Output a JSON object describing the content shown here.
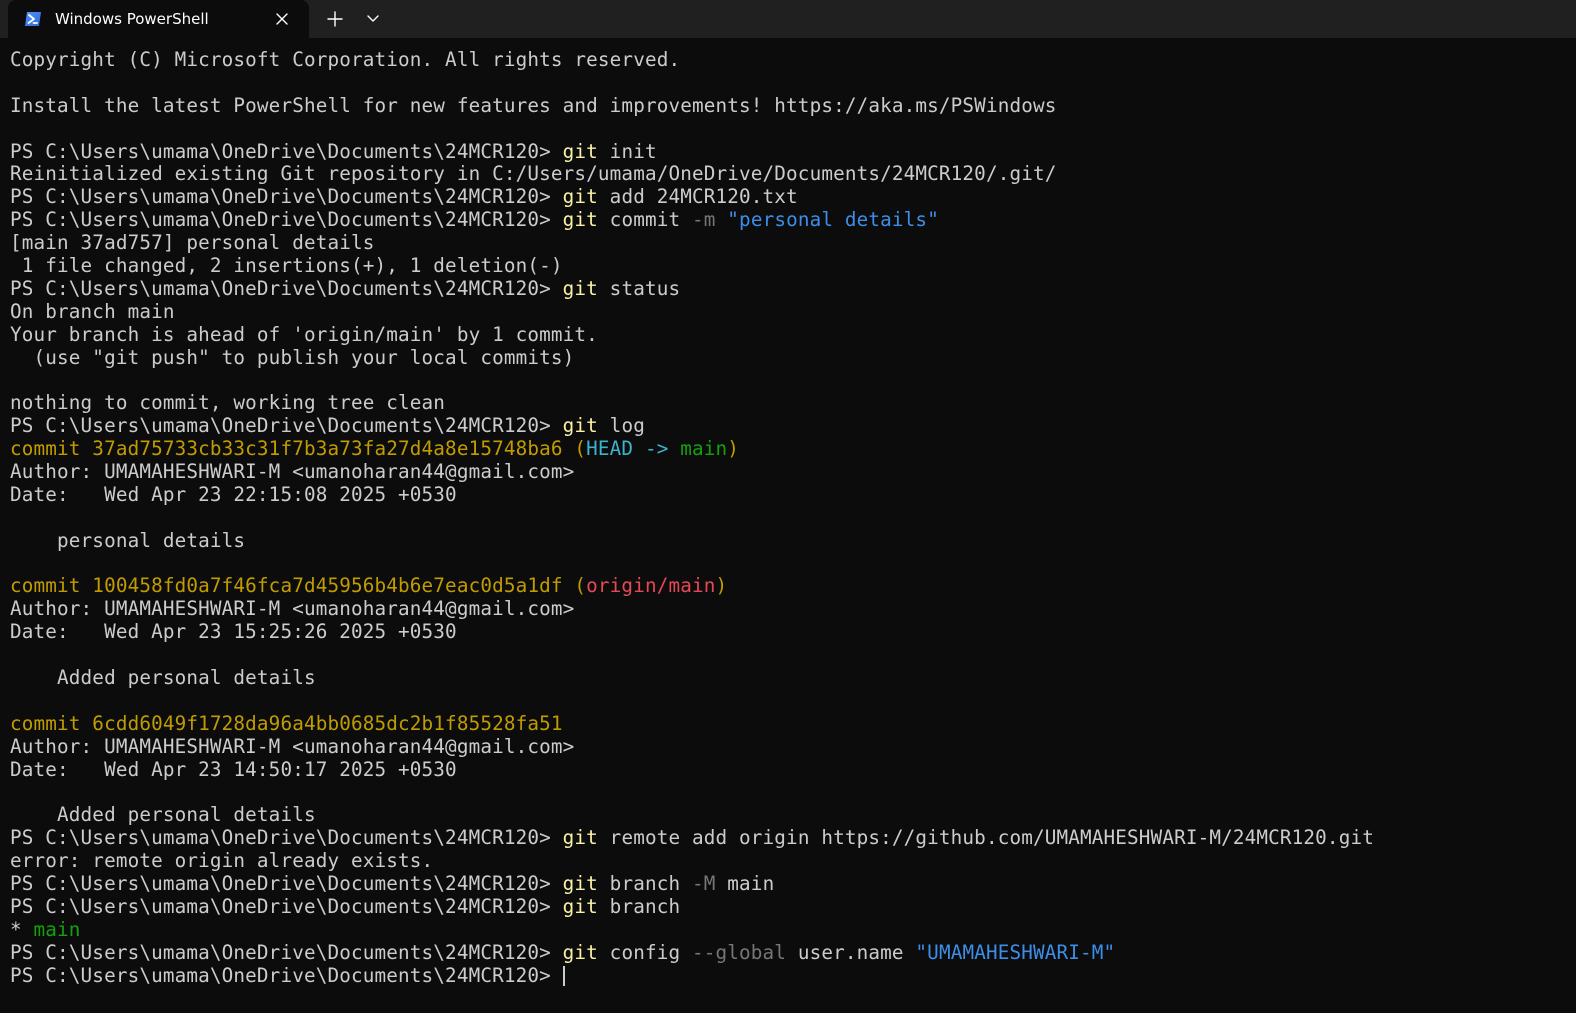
{
  "window": {
    "tab_title": "Windows PowerShell",
    "new_tab_label": "+",
    "icons": {
      "tab_icon": "powershell-icon",
      "close": "close-icon",
      "new_tab": "plus-icon",
      "dropdown": "chevron-down-icon"
    }
  },
  "colors": {
    "background": "#0c0c0c",
    "titlebar": "#202020",
    "text": "#cccccc",
    "command": "#f9f1a5",
    "flag": "#767676",
    "string": "#3b8eea",
    "commit_hash": "#c19c00",
    "head": "#3bb4cf",
    "branch": "#13a10e",
    "remote_branch": "#e74856"
  },
  "terminal": {
    "prompt": "PS C:\\Users\\umama\\OneDrive\\Documents\\24MCR120> ",
    "lines": [
      {
        "segments": [
          {
            "t": "Copyright (C) Microsoft Corporation. All rights reserved.",
            "c": ""
          }
        ]
      },
      {
        "segments": []
      },
      {
        "segments": [
          {
            "t": "Install the latest PowerShell for new features and improvements! https://aka.ms/PSWindows",
            "c": ""
          }
        ]
      },
      {
        "segments": []
      },
      {
        "prompt": true,
        "segments": [
          {
            "t": "git",
            "c": "cmd"
          },
          {
            "t": " init",
            "c": ""
          }
        ]
      },
      {
        "segments": [
          {
            "t": "Reinitialized existing Git repository in C:/Users/umama/OneDrive/Documents/24MCR120/.git/",
            "c": ""
          }
        ]
      },
      {
        "prompt": true,
        "segments": [
          {
            "t": "git",
            "c": "cmd"
          },
          {
            "t": " add 24MCR120.txt",
            "c": ""
          }
        ]
      },
      {
        "prompt": true,
        "segments": [
          {
            "t": "git",
            "c": "cmd"
          },
          {
            "t": " commit ",
            "c": ""
          },
          {
            "t": "-m",
            "c": "flag"
          },
          {
            "t": " ",
            "c": ""
          },
          {
            "t": "\"personal details\"",
            "c": "str"
          }
        ]
      },
      {
        "segments": [
          {
            "t": "[main 37ad757] personal details",
            "c": ""
          }
        ]
      },
      {
        "segments": [
          {
            "t": " 1 file changed, 2 insertions(+), 1 deletion(-)",
            "c": ""
          }
        ]
      },
      {
        "prompt": true,
        "segments": [
          {
            "t": "git",
            "c": "cmd"
          },
          {
            "t": " status",
            "c": ""
          }
        ]
      },
      {
        "segments": [
          {
            "t": "On branch main",
            "c": ""
          }
        ]
      },
      {
        "segments": [
          {
            "t": "Your branch is ahead of 'origin/main' by 1 commit.",
            "c": ""
          }
        ]
      },
      {
        "segments": [
          {
            "t": "  (use \"git push\" to publish your local commits)",
            "c": ""
          }
        ]
      },
      {
        "segments": []
      },
      {
        "segments": [
          {
            "t": "nothing to commit, working tree clean",
            "c": ""
          }
        ]
      },
      {
        "prompt": true,
        "segments": [
          {
            "t": "git",
            "c": "cmd"
          },
          {
            "t": " log",
            "c": ""
          }
        ]
      },
      {
        "segments": [
          {
            "t": "commit 37ad75733cb33c31f7b3a73fa27d4a8e15748ba6 (",
            "c": "yel"
          },
          {
            "t": "HEAD -> ",
            "c": "cyan"
          },
          {
            "t": "main",
            "c": "grn"
          },
          {
            "t": ")",
            "c": "yel"
          }
        ]
      },
      {
        "segments": [
          {
            "t": "Author: UMAMAHESHWARI-M <umanoharan44@gmail.com>",
            "c": ""
          }
        ]
      },
      {
        "segments": [
          {
            "t": "Date:   Wed Apr 23 22:15:08 2025 +0530",
            "c": ""
          }
        ]
      },
      {
        "segments": []
      },
      {
        "segments": [
          {
            "t": "    personal details",
            "c": ""
          }
        ]
      },
      {
        "segments": []
      },
      {
        "segments": [
          {
            "t": "commit 100458fd0a7f46fca7d45956b4b6e7eac0d5a1df (",
            "c": "yel"
          },
          {
            "t": "origin/main",
            "c": "red"
          },
          {
            "t": ")",
            "c": "yel"
          }
        ]
      },
      {
        "segments": [
          {
            "t": "Author: UMAMAHESHWARI-M <umanoharan44@gmail.com>",
            "c": ""
          }
        ]
      },
      {
        "segments": [
          {
            "t": "Date:   Wed Apr 23 15:25:26 2025 +0530",
            "c": ""
          }
        ]
      },
      {
        "segments": []
      },
      {
        "segments": [
          {
            "t": "    Added personal details",
            "c": ""
          }
        ]
      },
      {
        "segments": []
      },
      {
        "segments": [
          {
            "t": "commit 6cdd6049f1728da96a4bb0685dc2b1f85528fa51",
            "c": "yel"
          }
        ]
      },
      {
        "segments": [
          {
            "t": "Author: UMAMAHESHWARI-M <umanoharan44@gmail.com>",
            "c": ""
          }
        ]
      },
      {
        "segments": [
          {
            "t": "Date:   Wed Apr 23 14:50:17 2025 +0530",
            "c": ""
          }
        ]
      },
      {
        "segments": []
      },
      {
        "segments": [
          {
            "t": "    Added personal details",
            "c": ""
          }
        ]
      },
      {
        "prompt": true,
        "segments": [
          {
            "t": "git",
            "c": "cmd"
          },
          {
            "t": " remote add origin https://github.com/UMAMAHESHWARI-M/24MCR120.git",
            "c": ""
          }
        ]
      },
      {
        "segments": [
          {
            "t": "error: remote origin already exists.",
            "c": ""
          }
        ]
      },
      {
        "prompt": true,
        "segments": [
          {
            "t": "git",
            "c": "cmd"
          },
          {
            "t": " branch ",
            "c": ""
          },
          {
            "t": "-M",
            "c": "flag"
          },
          {
            "t": " main",
            "c": ""
          }
        ]
      },
      {
        "prompt": true,
        "segments": [
          {
            "t": "git",
            "c": "cmd"
          },
          {
            "t": " branch",
            "c": ""
          }
        ]
      },
      {
        "segments": [
          {
            "t": "* ",
            "c": ""
          },
          {
            "t": "main",
            "c": "grn"
          }
        ]
      },
      {
        "prompt": true,
        "segments": [
          {
            "t": "git",
            "c": "cmd"
          },
          {
            "t": " config ",
            "c": ""
          },
          {
            "t": "--global",
            "c": "flag"
          },
          {
            "t": " user.name ",
            "c": ""
          },
          {
            "t": "\"UMAMAHESHWARI-M\"",
            "c": "str"
          }
        ]
      },
      {
        "prompt": true,
        "cursor": true,
        "segments": []
      }
    ]
  }
}
